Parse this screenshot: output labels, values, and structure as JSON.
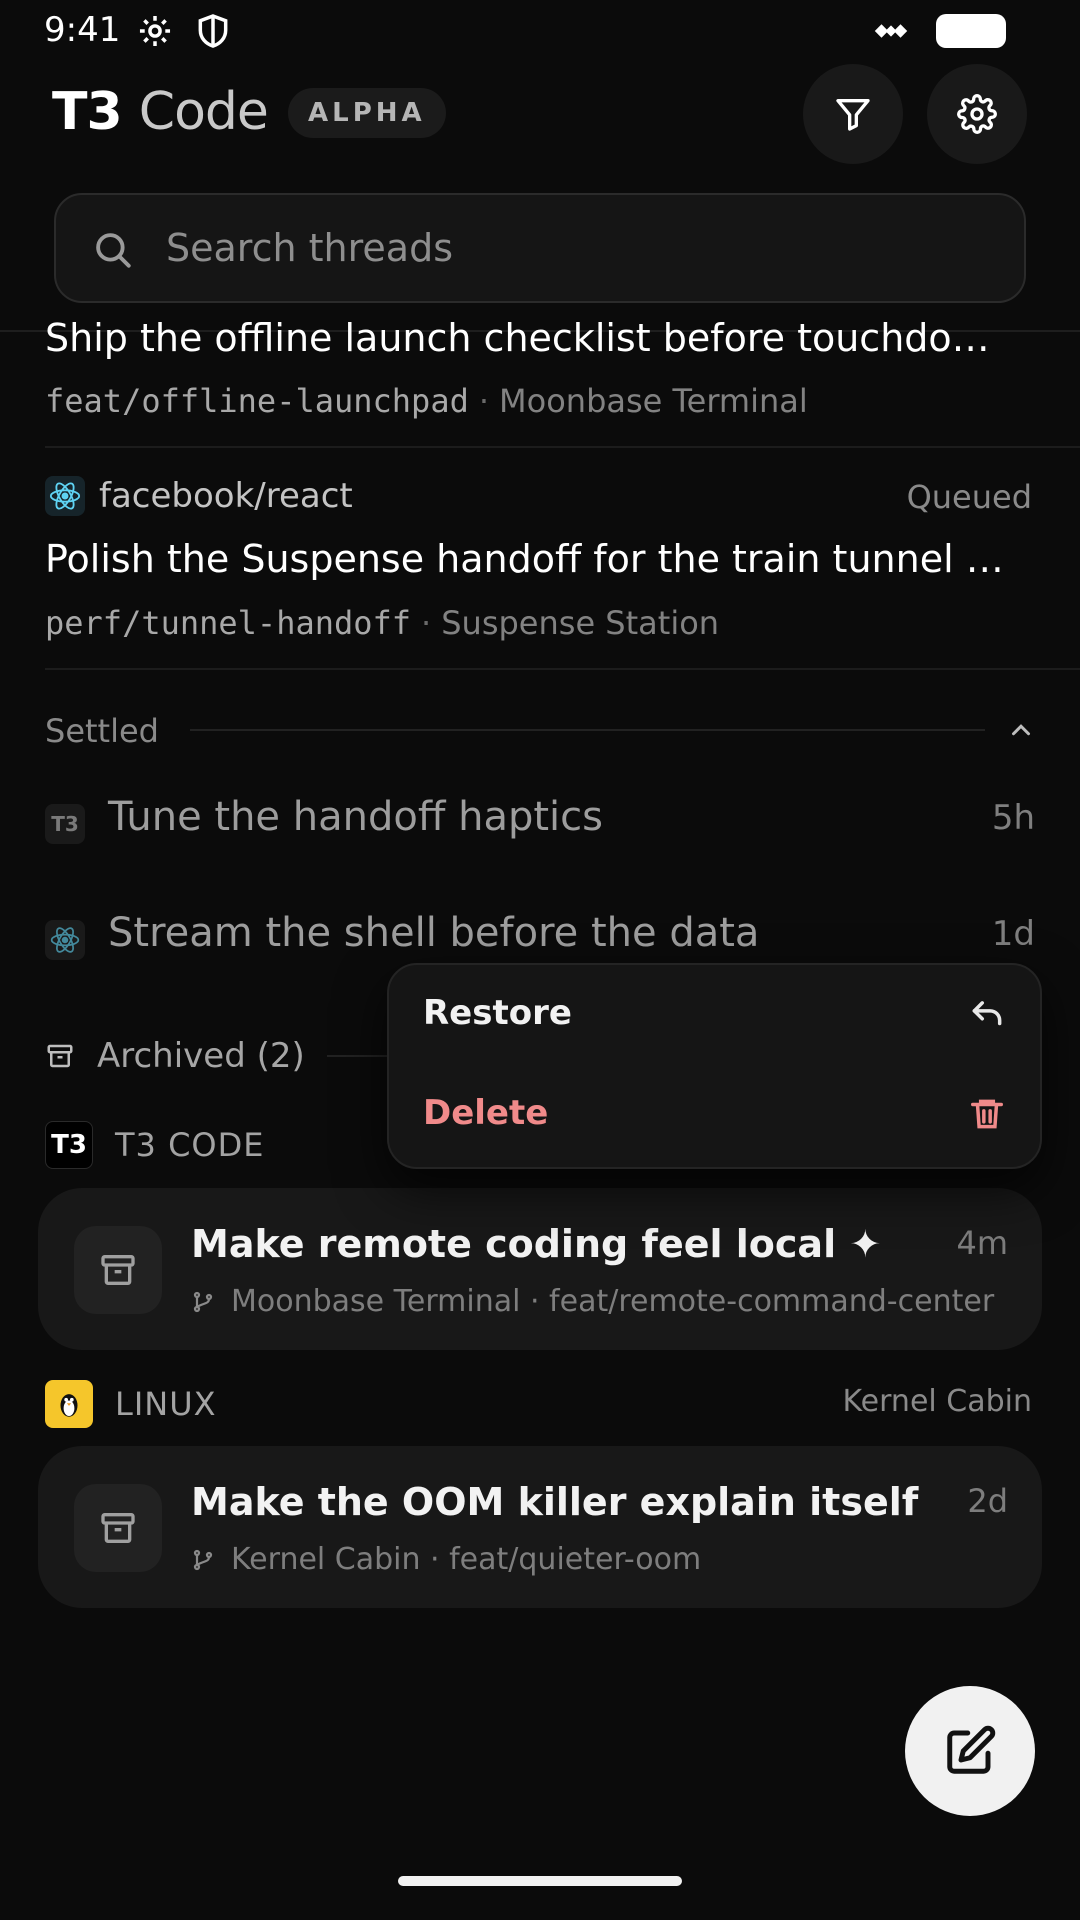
{
  "status_bar": {
    "time": "9:41"
  },
  "header": {
    "title_bold": "T3",
    "title_light": "Code",
    "badge": "ALPHA"
  },
  "search": {
    "placeholder": "Search threads",
    "value": ""
  },
  "threads": [
    {
      "title": "Ship the offline launch checklist before touchdo…",
      "branch": "feat/offline-launchpad",
      "project": "Moonbase Terminal"
    },
    {
      "repo": "facebook/react",
      "status": "Queued",
      "title": "Polish the Suspense handoff for the train tunnel …",
      "branch": "perf/tunnel-handoff",
      "project": "Suspense Station"
    }
  ],
  "settled": {
    "label": "Settled",
    "items": [
      {
        "icon_text": "T3",
        "title": "Tune the handoff haptics",
        "age": "5h"
      },
      {
        "title": "Stream the shell before the data",
        "age": "1d"
      }
    ]
  },
  "archived": {
    "label": "Archived (2)",
    "groups": [
      {
        "logo_text": "T3",
        "name": "T3 CODE",
        "right": "",
        "card": {
          "title": "Make remote coding feel local ✦",
          "age": "4m",
          "meta": "Moonbase Terminal · feat/remote-command-center"
        }
      },
      {
        "name": "LINUX",
        "right": "Kernel Cabin",
        "card": {
          "title": "Make the OOM killer explain itself",
          "age": "2d",
          "meta": "Kernel Cabin · feat/quieter-oom"
        }
      }
    ]
  },
  "context_menu": {
    "restore": "Restore",
    "delete": "Delete"
  },
  "colors": {
    "delete": "#f08a8a",
    "background": "#0b0b0b",
    "fab": "#f1f1f1"
  }
}
